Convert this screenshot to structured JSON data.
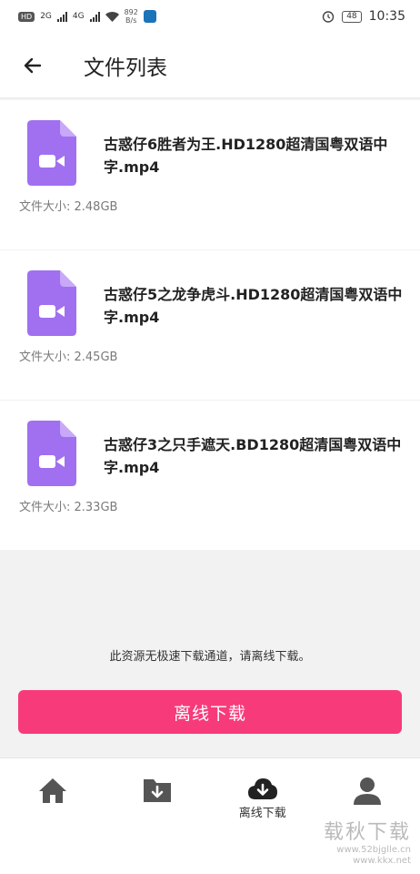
{
  "status_bar": {
    "network": "HD",
    "sim1": "2G",
    "sim2": "4G",
    "speed_value": "892",
    "speed_unit": "B/s",
    "battery": "48",
    "time": "10:35"
  },
  "header": {
    "title": "文件列表"
  },
  "files": [
    {
      "name": "古惑仔6胜者为王.HD1280超清国粤双语中字.mp4",
      "size": "文件大小: 2.48GB"
    },
    {
      "name": "古惑仔5之龙争虎斗.HD1280超清国粤双语中字.mp4",
      "size": "文件大小: 2.45GB"
    },
    {
      "name": "古惑仔3之只手遮天.BD1280超清国粤双语中字.mp4",
      "size": "文件大小: 2.33GB"
    }
  ],
  "notice": "此资源无极速下载通道，请离线下载。",
  "download_button": "离线下载",
  "tabs": [
    {
      "icon": "home-icon",
      "label": ""
    },
    {
      "icon": "folder-download-icon",
      "label": ""
    },
    {
      "icon": "cloud-download-icon",
      "label": "离线下载"
    },
    {
      "icon": "user-icon",
      "label": ""
    }
  ],
  "watermark": {
    "text": "载秋下载",
    "site1": "www.52bjglle.cn",
    "site2": "www.kkx.net"
  },
  "colors": {
    "accent": "#f73b7a",
    "file_icon": "#a070f0",
    "file_icon_fold": "#c8a8f8",
    "tab_icon": "#555555"
  }
}
